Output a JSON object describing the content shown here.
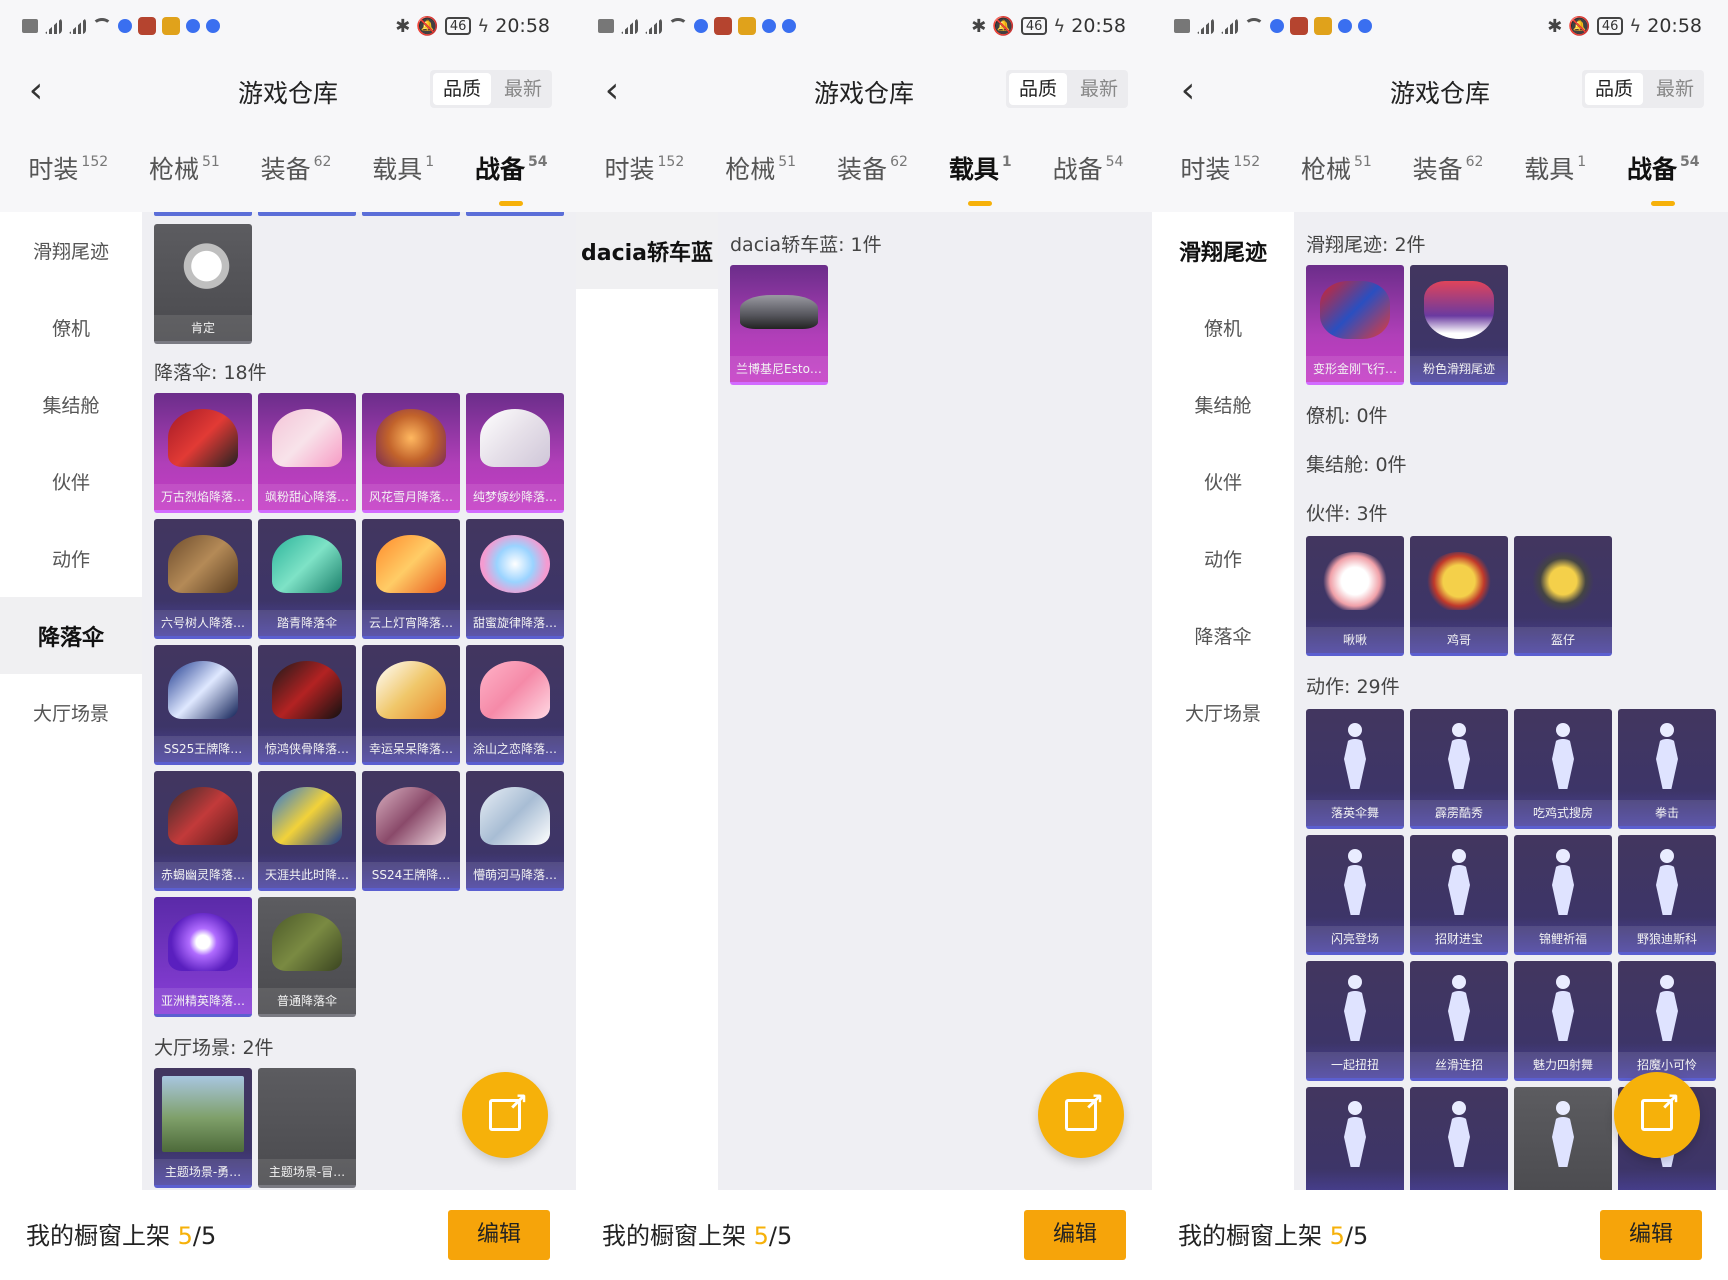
{
  "status": {
    "time": "20:58",
    "battery": "46"
  },
  "header": {
    "title": "游戏仓库",
    "sort": [
      "品质",
      "最新"
    ]
  },
  "tabs": [
    {
      "label": "时装",
      "count": "152"
    },
    {
      "label": "枪械",
      "count": "51"
    },
    {
      "label": "装备",
      "count": "62"
    },
    {
      "label": "载具",
      "count": "1"
    },
    {
      "label": "战备",
      "count": "54"
    }
  ],
  "sidebar_items": [
    "滑翔尾迹",
    "僚机",
    "集结舱",
    "伙伴",
    "动作",
    "降落伞",
    "大厅场景"
  ],
  "footer": {
    "prefix": "我的橱窗上架 ",
    "current": "5",
    "suffix": "/5",
    "edit": "编辑"
  },
  "panel1": {
    "top_item": "肯定",
    "parachute_label": "降落伞: 18件",
    "parachutes": [
      "万古烈焰降落…",
      "飒粉甜心降落…",
      "风花雪月降落…",
      "纯梦嫁纱降落…",
      "六号树人降落…",
      "踏青降落伞",
      "云上灯宵降落…",
      "甜蜜旋律降落…",
      "SS25王牌降…",
      "惊鸿侠骨降落…",
      "幸运呆呆降落…",
      "涂山之恋降落…",
      "赤蝎幽灵降落…",
      "天涯共此时降…",
      "SS24王牌降…",
      "懵萌河马降落…",
      "亚洲精英降落…",
      "普通降落伞"
    ],
    "lobby_label": "大厅场景: 2件",
    "lobby": [
      "主题场景-勇…",
      "主题场景-冒…"
    ]
  },
  "panel2": {
    "side_label": "dacia轿车蓝",
    "section_label": "dacia轿车蓝: 1件",
    "vehicle": "兰博基尼Esto…"
  },
  "panel3": {
    "trail_label": "滑翔尾迹: 2件",
    "trails": [
      "变形金刚飞行…",
      "粉色滑翔尾迹"
    ],
    "wingman_label": "僚机: 0件",
    "pod_label": "集结舱: 0件",
    "partner_label": "伙伴: 3件",
    "partners": [
      "啾啾",
      "鸡哥",
      "盔仔"
    ],
    "emote_label": "动作: 29件",
    "emotes": [
      "落英伞舞",
      "霹雳酷秀",
      "吃鸡式搜房",
      "拳击",
      "闪亮登场",
      "招财进宝",
      "锦鲤祈福",
      "野狼迪斯科",
      "一起扭扭",
      "丝滑连招",
      "魅力四射舞",
      "招魔小可怜"
    ]
  }
}
